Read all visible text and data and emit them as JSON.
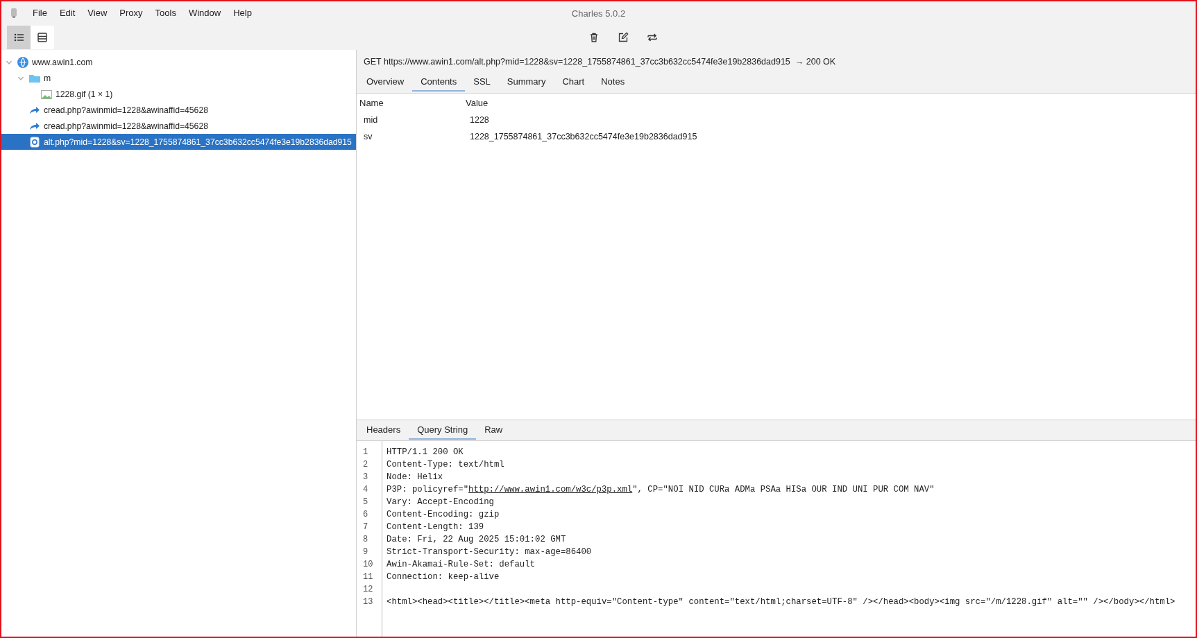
{
  "window": {
    "title": "Charles 5.0.2"
  },
  "menu": [
    "File",
    "Edit",
    "View",
    "Proxy",
    "Tools",
    "Window",
    "Help"
  ],
  "view_buttons": [
    {
      "kind": "list",
      "selected": true
    },
    {
      "kind": "table",
      "selected": false
    }
  ],
  "toolbar": [
    {
      "kind": "trash"
    },
    {
      "kind": "edit"
    },
    {
      "kind": "repeat"
    }
  ],
  "tree": [
    {
      "label": "www.awin1.com",
      "kind": "host",
      "expanded": true,
      "selected": false,
      "children": [
        {
          "label": "m",
          "kind": "folder",
          "expanded": true,
          "selected": false,
          "children": [
            {
              "label": "1228.gif (1 × 1)",
              "kind": "image",
              "selected": false
            }
          ]
        },
        {
          "label": "cread.php?awinmid=1228&awinaffid=45628",
          "kind": "redirect",
          "selected": false
        },
        {
          "label": "cread.php?awinmid=1228&awinaffid=45628",
          "kind": "redirect",
          "selected": false
        },
        {
          "label": "alt.php?mid=1228&sv=1228_1755874861_37cc3b632cc5474fe3e19b2836dad915",
          "kind": "document",
          "selected": true
        }
      ]
    }
  ],
  "request_line": "GET https://www.awin1.com/alt.php?mid=1228&sv=1228_1755874861_37cc3b632cc5474fe3e19b2836dad915  → 200 OK",
  "upper_tabs": [
    {
      "label": "Overview",
      "selected": false
    },
    {
      "label": "Contents",
      "selected": true
    },
    {
      "label": "SSL",
      "selected": false
    },
    {
      "label": "Summary",
      "selected": false
    },
    {
      "label": "Chart",
      "selected": false
    },
    {
      "label": "Notes",
      "selected": false
    }
  ],
  "params": {
    "columns": [
      "Name",
      "Value"
    ],
    "rows": [
      [
        "mid",
        "1228"
      ],
      [
        "sv",
        "1228_1755874861_37cc3b632cc5474fe3e19b2836dad915"
      ]
    ]
  },
  "lower_tabs": [
    {
      "label": "Headers",
      "selected": false
    },
    {
      "label": "Query String",
      "selected": true
    },
    {
      "label": "Raw",
      "selected": false
    }
  ],
  "code_lines": [
    {
      "number": "1",
      "segments": [
        {
          "kind": "plain",
          "text": "HTTP/1.1 200 OK"
        }
      ]
    },
    {
      "number": "2",
      "segments": [
        {
          "kind": "plain",
          "text": "Content-Type: text/html"
        }
      ]
    },
    {
      "number": "3",
      "segments": [
        {
          "kind": "plain",
          "text": "Node: Helix"
        }
      ]
    },
    {
      "number": "4",
      "segments": [
        {
          "kind": "plain",
          "text": "P3P: policyref=\""
        },
        {
          "kind": "link",
          "text": "http://www.awin1.com/w3c/p3p.xml"
        },
        {
          "kind": "plain",
          "text": "\", CP=\"NOI NID CURa ADMa PSAa HISa OUR IND UNI PUR COM NAV\""
        }
      ]
    },
    {
      "number": "5",
      "segments": [
        {
          "kind": "plain",
          "text": "Vary: Accept-Encoding"
        }
      ]
    },
    {
      "number": "6",
      "segments": [
        {
          "kind": "plain",
          "text": "Content-Encoding: gzip"
        }
      ]
    },
    {
      "number": "7",
      "segments": [
        {
          "kind": "plain",
          "text": "Content-Length: 139"
        }
      ]
    },
    {
      "number": "8",
      "segments": [
        {
          "kind": "plain",
          "text": "Date: Fri, 22 Aug 2025 15:01:02 GMT"
        }
      ]
    },
    {
      "number": "9",
      "segments": [
        {
          "kind": "plain",
          "text": "Strict-Transport-Security: max-age=86400"
        }
      ]
    },
    {
      "number": "10",
      "segments": [
        {
          "kind": "plain",
          "text": "Awin-Akamai-Rule-Set: default"
        }
      ]
    },
    {
      "number": "11",
      "segments": [
        {
          "kind": "plain",
          "text": "Connection: keep-alive"
        }
      ]
    },
    {
      "number": "12"
    },
    {
      "number": "13",
      "segments": [
        {
          "kind": "plain",
          "text": "<html><head><title></title><meta http-equiv=\"Content-type\" content=\"text/html;charset=UTF-8\" /></head><body><img src=\"/m/1228.gif\" alt=\"\" /></body></html>"
        }
      ]
    }
  ]
}
